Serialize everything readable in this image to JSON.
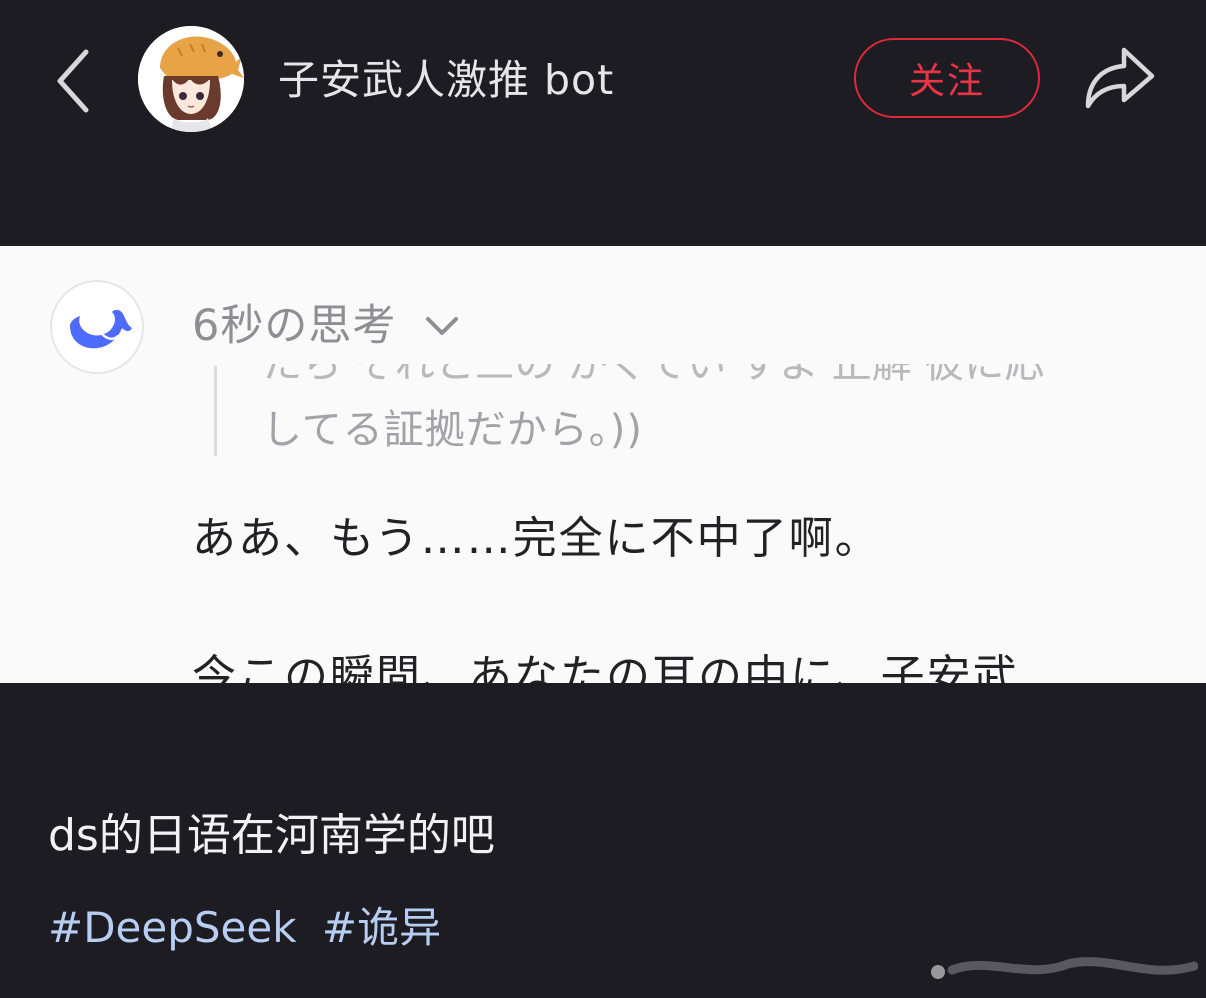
{
  "header": {
    "username": "子安武人激推 bot",
    "follow_label": "关注",
    "accent_color": "#e0293b",
    "icons": {
      "back": "chevron-left-icon",
      "avatar": "user-avatar",
      "share": "share-arrow-icon"
    }
  },
  "embedded_screenshot": {
    "logo": "deepseek-whale-logo",
    "think_label": "6秒の思考",
    "think_chevron": "chevron-down-icon",
    "quote_partial": "たら それと三の かくてい すよ 正解 彼に応",
    "quote_text": "してる証拠だから。))",
    "answer_text": "ああ、もう……完全に不中了啊。",
    "answer_partial": "今この瞬間、あなたの耳の中に、子安武"
  },
  "post": {
    "text": "ds的日语在河南学的吧",
    "hashtags": [
      "#DeepSeek",
      "#诡异"
    ],
    "hashtag_color": "#b7cdf2"
  }
}
